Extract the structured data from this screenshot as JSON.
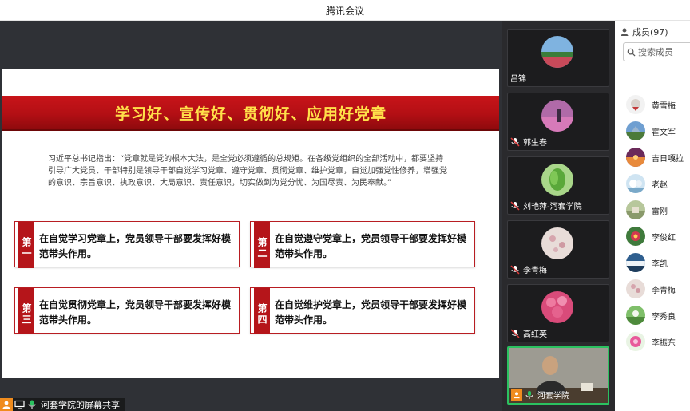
{
  "window": {
    "title": "腾讯会议"
  },
  "slide": {
    "title": "学习好、宣传好、贯彻好、应用好党章",
    "quote": "习近平总书记指出：“党章就是党的根本大法，是全党必须遵循的总规矩。在各级党组织的全部活动中，都要坚持引导广大党员、干部特别是领导干部自觉学习党章、遵守党章、贯彻党章、维护党章，自觉加强党性修养，增强党的意识、宗旨意识、执政意识、大局意识、责任意识，切实做到为党分忧、为国尽责、为民奉献。”",
    "cards": [
      {
        "badge": "第一",
        "text": "在自觉学习党章上，党员领导干部要发挥好模范带头作用。"
      },
      {
        "badge": "第二",
        "text": "在自觉遵守党章上，党员领导干部要发挥好模范带头作用。"
      },
      {
        "badge": "第三",
        "text": "在自觉贯彻党章上，党员领导干部要发挥好模范带头作用。"
      },
      {
        "badge": "第四",
        "text": "在自觉维护党章上，党员领导干部要发挥好模范带头作用。"
      }
    ]
  },
  "share": {
    "label": "河套学院的屏幕共享"
  },
  "tiles": [
    {
      "name": "吕锦"
    },
    {
      "name": "郭生春"
    },
    {
      "name": "刘艳萍-河套学院"
    },
    {
      "name": "李青梅"
    },
    {
      "name": "高红英"
    },
    {
      "name": "河套学院"
    }
  ],
  "members": {
    "header": "成员(97)",
    "search_placeholder": "搜索成员",
    "list": [
      {
        "name": "黄雪梅"
      },
      {
        "name": "霍文军"
      },
      {
        "name": "吉日嘎拉"
      },
      {
        "name": "老赵"
      },
      {
        "name": "雷刚"
      },
      {
        "name": "李俊红"
      },
      {
        "name": "李凯"
      },
      {
        "name": "李青梅"
      },
      {
        "name": "李秀良"
      },
      {
        "name": "李振东"
      }
    ]
  },
  "colors": {
    "accent_red": "#b5151a",
    "title_yellow": "#ffe04a",
    "active_green": "#2bc160",
    "share_orange": "#f08c1e"
  }
}
